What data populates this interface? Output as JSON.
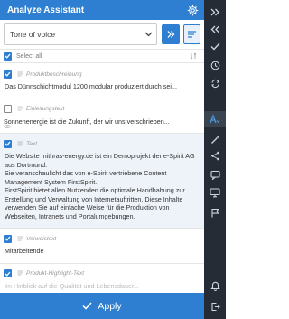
{
  "header": {
    "title": "Analyze Assistant"
  },
  "toolbar": {
    "dropdown_value": "Tone of voice"
  },
  "select_all": {
    "label": "Select all"
  },
  "items": [
    {
      "type": "Produktbeschreibung",
      "checked": true,
      "text": "Das Dünnschichtmodul 1200 modular produziert durch sei..."
    },
    {
      "type": "Einleitungstext",
      "checked": false,
      "text": "Sonnenenergie ist die Zukunft, der wir uns verschrieben..."
    },
    {
      "type": "Text",
      "checked": true,
      "text": "Die Website mithras-energy.de ist ein Demoprojekt der e-Spirit AG aus Dortmund.\nSie veranschaulicht das von e-Spirit vertriebene Content Management System FirstSpirit.\nFirstSpirit bietet allen Nutzenden die optimale Handhabung zur Erstellung und Verwaltung von Internetauftritten. Diese Inhalte verwenden Sie auf einfache Weise für die Produktion von Webseiten, Intranets und Portalumgebungen."
    },
    {
      "type": "Verweistext",
      "checked": true,
      "text": "Mitarbeitende"
    },
    {
      "type": "Produkt-Highlight-Text",
      "checked": true,
      "text": "Im Hinblick auf die Qualität und Lebensdauer..."
    }
  ],
  "apply": {
    "label": "Apply"
  },
  "sidebar": {
    "icons": [
      "expand-icon",
      "collapse-icon",
      "check-icon",
      "history-icon",
      "recycle-icon",
      "translate-icon",
      "magic-icon",
      "share-icon",
      "chat-icon",
      "display-icon",
      "flag-icon",
      "bell-icon",
      "logout-icon"
    ],
    "active": "translate-icon"
  },
  "colors": {
    "accent": "#2e7fd1",
    "sidebar": "#252c36"
  }
}
